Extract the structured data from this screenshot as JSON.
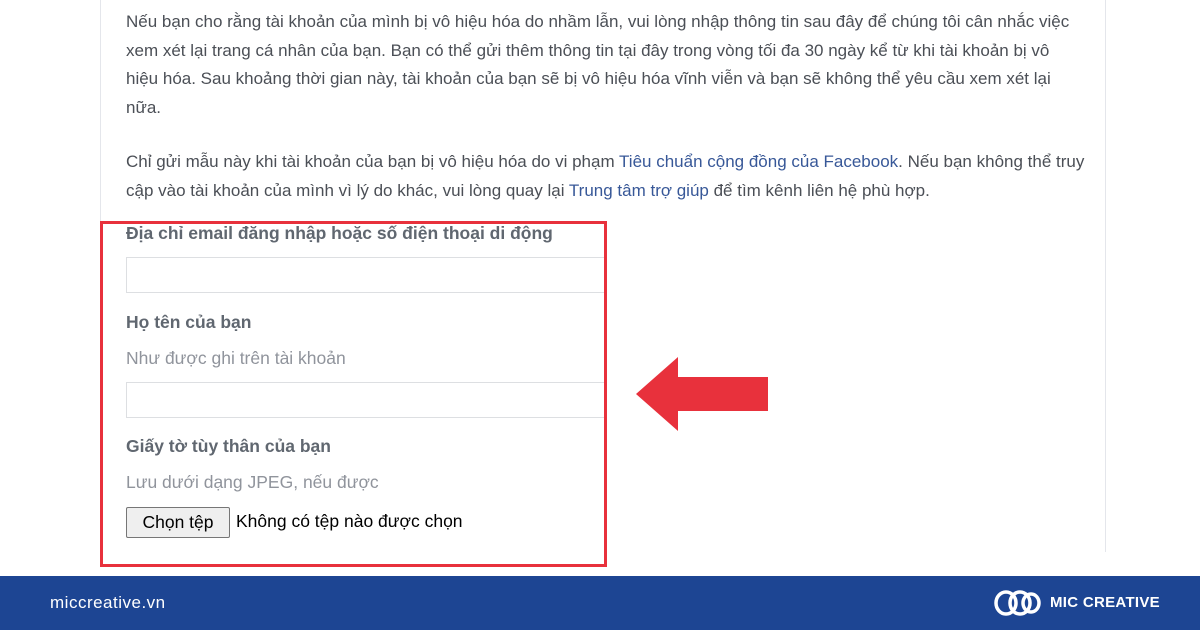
{
  "intro": {
    "paragraph1": "Nếu bạn cho rằng tài khoản của mình bị vô hiệu hóa do nhầm lẫn, vui lòng nhập thông tin sau đây để chúng tôi cân nhắc việc xem xét lại trang cá nhân của bạn. Bạn có thể gửi thêm thông tin tại đây trong vòng tối đa 30 ngày kể từ khi tài khoản bị vô hiệu hóa. Sau khoảng thời gian này, tài khoản của bạn sẽ bị vô hiệu hóa vĩnh viễn và bạn sẽ không thể yêu cầu xem xét lại nữa.",
    "paragraph2_part1": "Chỉ gửi mẫu này khi tài khoản của bạn bị vô hiệu hóa do vi phạm ",
    "community_standards_link": "Tiêu chuẩn cộng đồng của Facebook",
    "paragraph2_part2": ". Nếu bạn không thể truy cập vào tài khoản của mình vì lý do khác, vui lòng quay lại ",
    "help_center_link": "Trung tâm trợ giúp",
    "paragraph2_part3": " để tìm kênh liên hệ phù hợp."
  },
  "form": {
    "email_label": "Địa chỉ email đăng nhập hoặc số điện thoại di động",
    "email_value": "",
    "name_label": "Họ tên của bạn",
    "name_hint": "Như được ghi trên tài khoản",
    "name_value": "",
    "id_label": "Giấy tờ tùy thân của bạn",
    "id_hint": "Lưu dưới dạng JPEG, nếu được",
    "file_button_label": "Chọn tệp",
    "file_status": "Không có tệp nào được chọn"
  },
  "annotation": {
    "highlight_color": "#e8313c",
    "arrow_color": "#e8313c",
    "arrow_direction": "left"
  },
  "footer": {
    "site": "miccreative.vn",
    "brand": "MIC CREATIVE",
    "background_color": "#1d4593"
  },
  "colors": {
    "link": "#385898",
    "body_text": "#4b4f56",
    "label_text": "#606770",
    "hint_text": "#90949c"
  },
  "icons": [
    "mic-creative-logo-icon",
    "left-arrow-icon"
  ]
}
